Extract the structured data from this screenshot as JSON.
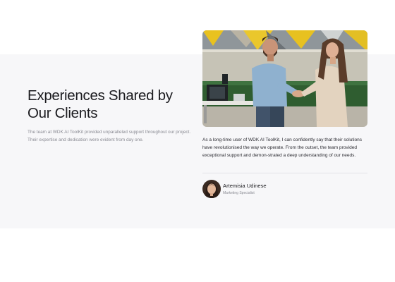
{
  "section": {
    "heading": "Experiences Shared by Our Clients",
    "intro": "The team at WDK AI ToolKit provided unparalleled support throughout our project. Their expertise and dedication were evident from day one."
  },
  "testimonial": {
    "quote": "As a long-time user of WDK AI ToolKit, I can confidently say that their solutions have revolutionised the way we operate. From the outset, the team provided exceptional support and demon-strated a deep understanding of our needs.",
    "author_name": "Artemisia Udinese",
    "author_role": "Marketing Specialist"
  },
  "colors": {
    "band_background": "#f7f7f9",
    "heading": "#1b1b1f",
    "muted_text": "#8a8b93"
  }
}
